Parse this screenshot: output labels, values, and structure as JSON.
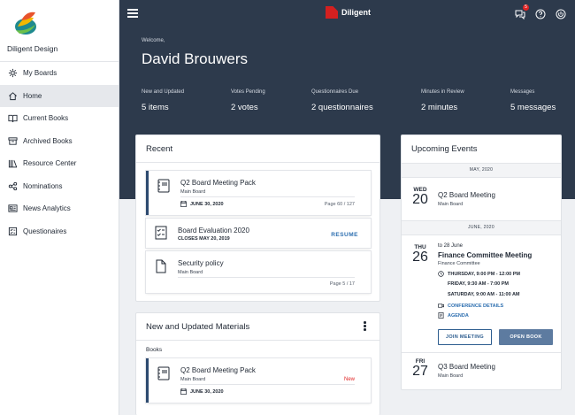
{
  "sidebar": {
    "brand_name": "Diligent Design",
    "items": [
      {
        "label": "My Boards",
        "icon": "boards-icon"
      },
      {
        "label": "Home",
        "icon": "home-icon",
        "active": true
      },
      {
        "label": "Current Books",
        "icon": "book-open-icon"
      },
      {
        "label": "Archived Books",
        "icon": "archive-icon"
      },
      {
        "label": "Resource Center",
        "icon": "library-icon"
      },
      {
        "label": "Nominations",
        "icon": "nominations-icon"
      },
      {
        "label": "News Analytics",
        "icon": "news-icon"
      },
      {
        "label": "Questionaires",
        "icon": "checklist-icon"
      }
    ]
  },
  "header": {
    "app_name": "Diligent",
    "notification_count": "5",
    "welcome": "Welcome,",
    "user_name": "David Brouwers",
    "stats": [
      {
        "label": "New and Updated",
        "value": "5 items"
      },
      {
        "label": "Votes Pending",
        "value": "2 votes"
      },
      {
        "label": "Questionnaires Due",
        "value": "2 questionnaires"
      },
      {
        "label": "Minutes in Review",
        "value": "2 minutes"
      },
      {
        "label": "Messages",
        "value": "5 messages"
      }
    ]
  },
  "recent": {
    "title": "Recent",
    "items": [
      {
        "title": "Q2 Board Meeting Pack",
        "subtitle": "Main Board",
        "date": "JUNE 30, 2020",
        "page": "Page 60 / 127"
      },
      {
        "title": "Board Evaluation 2020",
        "closes": "CLOSES MAY 20, 2019",
        "action": "RESUME"
      },
      {
        "title": "Security policy",
        "subtitle": "Main Board",
        "page": "Page 5 / 17"
      }
    ]
  },
  "materials": {
    "title": "New and Updated Materials",
    "section": "Books",
    "items": [
      {
        "title": "Q2 Board Meeting Pack",
        "subtitle": "Main Board",
        "date": "JUNE 30, 2020",
        "tag": "New"
      }
    ]
  },
  "events": {
    "title": "Upcoming Events",
    "months": [
      "MAY, 2020",
      "JUNE, 2020"
    ],
    "list": [
      {
        "dow": "WED",
        "day": "20",
        "title": "Q2 Board Meeting",
        "subtitle": "Main Board"
      },
      {
        "dow": "THU",
        "day": "26",
        "range": "to 28 June",
        "title": "Finance Committee Meeting",
        "subtitle": "Finance Committee",
        "times": [
          "THURSDAY, 9:00 PM - 12:00 PM",
          "FRIDAY, 9:30 AM - 7:00 PM",
          "SATURDAY, 9:00 AM - 11:00 AM"
        ],
        "conference": "CONFERENCE DETAILS",
        "agenda": "AGENDA",
        "join": "JOIN MEETING",
        "open": "OPEN BOOK"
      },
      {
        "dow": "FRI",
        "day": "27",
        "title": "Q3 Board Meeting",
        "subtitle": "Main Board"
      }
    ]
  },
  "colors": {
    "header_bg": "#2d3a4c",
    "accent": "#2d6fb0",
    "brand_red": "#d32020",
    "new_tag": "#e02424"
  }
}
